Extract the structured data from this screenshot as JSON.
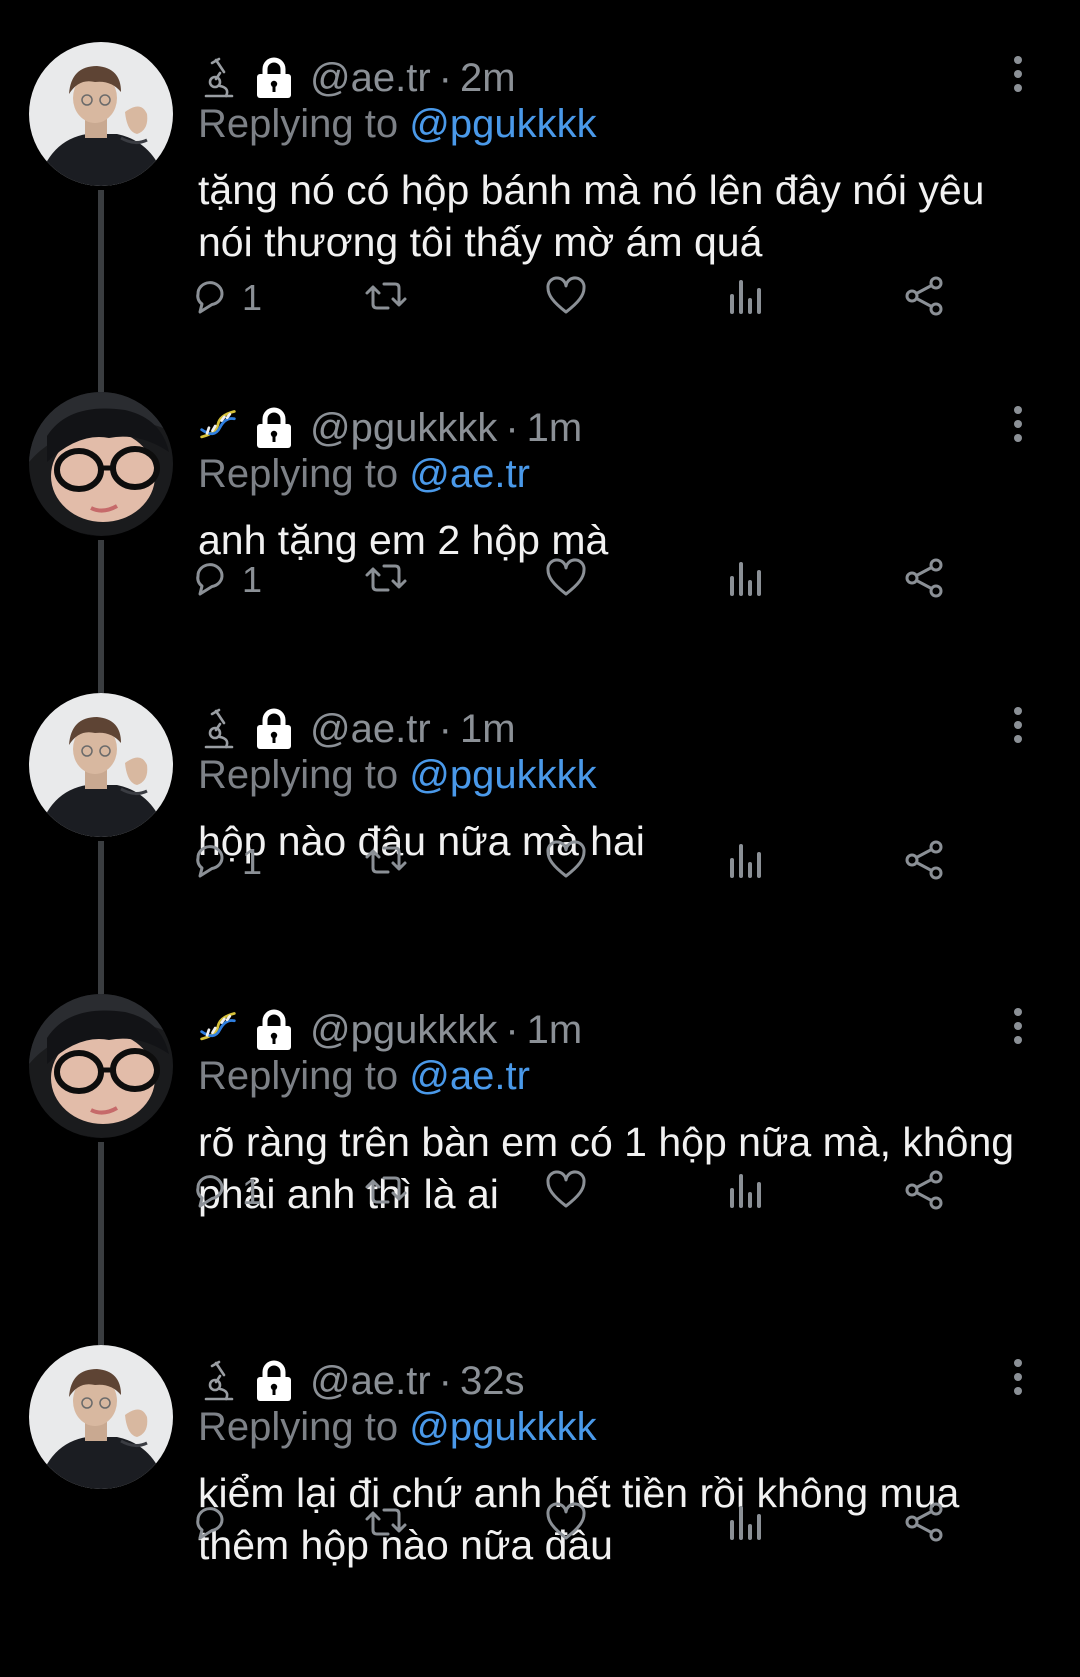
{
  "colors": {
    "background": "#000000",
    "text": "#f1f1f1",
    "muted": "#8b9096",
    "link": "#4a99e9",
    "line": "#3a3d40"
  },
  "tweets": [
    {
      "author_emoji": "microscope-icon",
      "handle": "@ae.tr",
      "separator": "·",
      "time": "2m",
      "replying_label": "Replying to",
      "replying_to": "@pgukkkk",
      "text": "tặng nó có hộp bánh mà nó lên đây nói yêu nói thương tôi thấy mờ ám quá",
      "reply_count": "1"
    },
    {
      "author_emoji": "dna-icon",
      "handle": "@pgukkkk",
      "separator": "·",
      "time": "1m",
      "replying_label": "Replying to",
      "replying_to": "@ae.tr",
      "text": "anh tặng em 2 hộp mà",
      "reply_count": "1"
    },
    {
      "author_emoji": "microscope-icon",
      "handle": "@ae.tr",
      "separator": "·",
      "time": "1m",
      "replying_label": "Replying to",
      "replying_to": "@pgukkkk",
      "text": "hộp nào đâu nữa mà hai",
      "reply_count": "1"
    },
    {
      "author_emoji": "dna-icon",
      "handle": "@pgukkkk",
      "separator": "·",
      "time": "1m",
      "replying_label": "Replying to",
      "replying_to": "@ae.tr",
      "text": "rõ ràng trên bàn em có 1 hộp nữa mà, không phải anh thì là ai",
      "reply_count": "1"
    },
    {
      "author_emoji": "microscope-icon",
      "handle": "@ae.tr",
      "separator": "·",
      "time": "32s",
      "replying_label": "Replying to",
      "replying_to": "@pgukkkk",
      "text": "kiểm lại đi chứ anh hết tiền rồi không mua thêm hộp nào nữa đâu",
      "reply_count": ""
    }
  ]
}
